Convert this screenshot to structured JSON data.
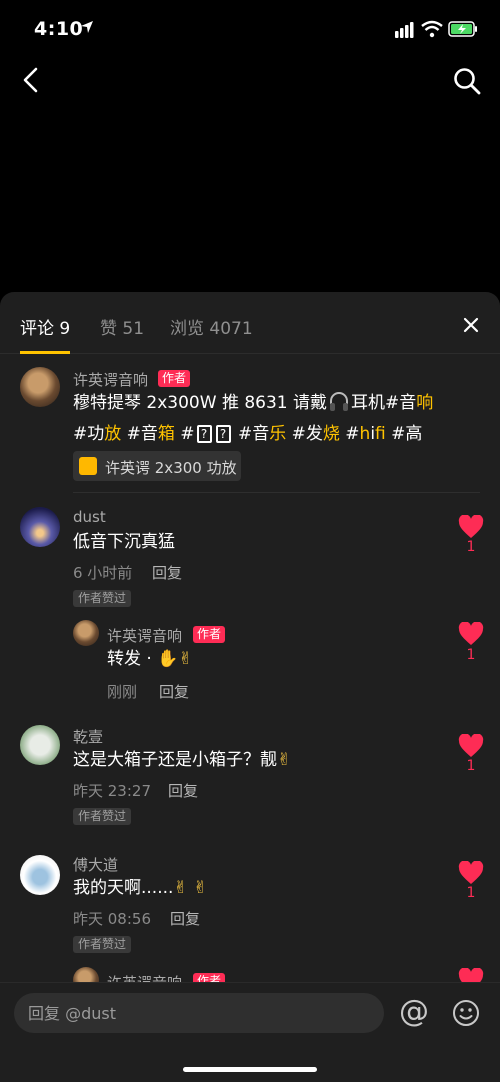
{
  "status_bar": {
    "time": "4:10"
  },
  "tabs": [
    {
      "label": "评论 9"
    },
    {
      "label": "赞 51"
    },
    {
      "label": "浏览 4071"
    }
  ],
  "author_badge": "作者",
  "author_liked_badge": "作者赞过",
  "reply_label": "回复",
  "post": {
    "author": "许英谔音响",
    "line1_a": "穆特提琴 2x300W 推 8631 请戴",
    "line1_b": "耳机#音",
    "line1_c": "响",
    "line2_a": "#功",
    "line2_b": "放",
    "line2_c": " #音",
    "line2_d": "箱",
    "line2_e": " #",
    "line2_f": " #音",
    "line2_g": "乐",
    "line2_h": " #发",
    "line2_i": "烧",
    "line2_j": " #",
    "line2_k": "h",
    "line2_l": "i",
    "line2_m": "fi",
    "line2_n": " #高",
    "product": "许英谔 2x300 功放"
  },
  "comments": [
    {
      "user": "dust",
      "text": "低音下沉真猛",
      "time": "6 小时前",
      "likes": "1"
    },
    {
      "user": "许英谔音响",
      "text": "转发 · ",
      "time": "刚刚",
      "likes": "1"
    },
    {
      "user": "乾壹",
      "text": "这是大箱子还是小箱子？靓",
      "time": "昨天 23:27",
      "likes": "1"
    },
    {
      "user": "傅大道",
      "text": "我的天啊......",
      "time": "昨天 08:56",
      "likes": "1"
    },
    {
      "user": "许英谔音响"
    }
  ],
  "input": {
    "placeholder": "回复 @dust"
  },
  "colors": {
    "accent": "#ffc300",
    "like": "#fe2c55",
    "sheet": "#1f1f1f"
  }
}
